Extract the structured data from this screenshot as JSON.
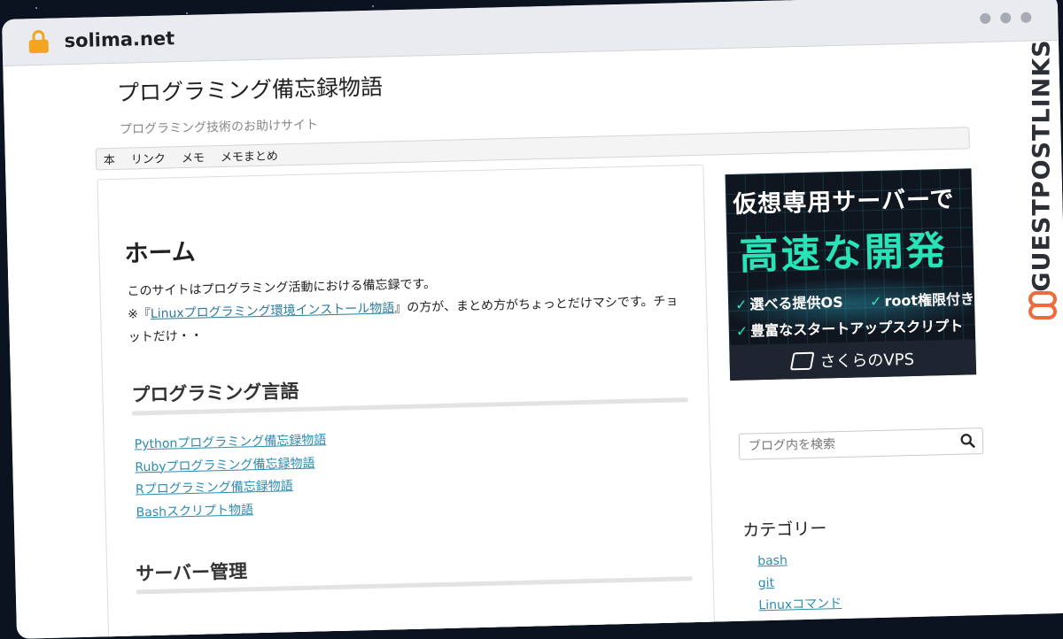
{
  "browser": {
    "domain": "solima.net"
  },
  "site": {
    "title": "プログラミング備忘録物語",
    "subtitle": "プログラミング技術のお助けサイト"
  },
  "nav": {
    "items": [
      "本",
      "リンク",
      "メモ",
      "メモまとめ"
    ]
  },
  "main": {
    "heading": "ホーム",
    "intro_line1": "このサイトはプログラミング活動における備忘録です。",
    "intro_prefix": "※『",
    "intro_link": "Linuxプログラミング環境インストール物語",
    "intro_suffix": "』の方が、まとめ方がちょっとだけマシです。チョットだけ・・",
    "sections": [
      {
        "title": "プログラミング言語",
        "links": [
          "Pythonプログラミング備忘録物語",
          "Rubyプログラミング備忘録物語",
          "Rプログラミング備忘録物語",
          "Bashスクリプト物語"
        ]
      },
      {
        "title": "サーバー管理"
      }
    ]
  },
  "ad": {
    "line1": "仮想専用サーバーで",
    "line2": "高速な開発",
    "features": [
      "選べる提供OS",
      "root権限付き",
      "豊富なスタートアップスクリプト"
    ],
    "brand": "さくらのVPS",
    "accent_color": "#29e3b8"
  },
  "sidebar": {
    "search_placeholder": "ブログ内を検索",
    "categories_title": "カテゴリー",
    "categories": [
      "bash",
      "git",
      "Linuxコマンド"
    ]
  },
  "watermark": {
    "text": "GUESTPOSTLINKS"
  }
}
